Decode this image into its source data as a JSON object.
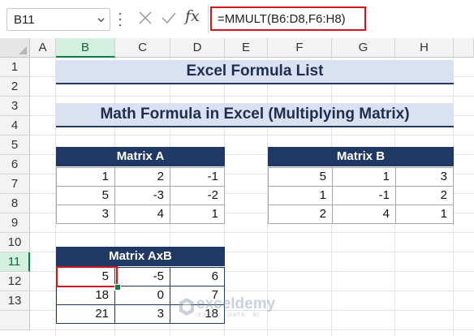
{
  "formula_bar": {
    "name_box": "B11",
    "fx_label": "fx",
    "formula": "=MMULT(B6:D8,F6:H8)"
  },
  "columns": [
    "A",
    "B",
    "C",
    "D",
    "E",
    "F",
    "G",
    "H"
  ],
  "rows": [
    "1",
    "2",
    "3",
    "4",
    "5",
    "6",
    "7",
    "8",
    "9",
    "10",
    "11",
    "12",
    "13"
  ],
  "title": "Excel Formula List",
  "subtitle": "Math Formula in Excel (Multiplying Matrix)",
  "matrix_a": {
    "header": "Matrix A",
    "values": [
      [
        "1",
        "2",
        "-1"
      ],
      [
        "5",
        "-3",
        "-2"
      ],
      [
        "3",
        "4",
        "1"
      ]
    ]
  },
  "matrix_b": {
    "header": "Matrix B",
    "values": [
      [
        "5",
        "1",
        "3"
      ],
      [
        "1",
        "-1",
        "2"
      ],
      [
        "2",
        "4",
        "1"
      ]
    ]
  },
  "matrix_axb": {
    "header": "Matrix AxB",
    "values": [
      [
        "5",
        "-5",
        "6"
      ],
      [
        "18",
        "0",
        "7"
      ],
      [
        "21",
        "3",
        "18"
      ]
    ]
  },
  "watermark": {
    "name": "exceldemy",
    "tagline": "EXCEL · DATA · BI"
  },
  "colors": {
    "header_navy": "#203864",
    "title_fill": "#d9e1f2",
    "highlight_red": "#d0171d",
    "selection_green": "#107c41"
  }
}
